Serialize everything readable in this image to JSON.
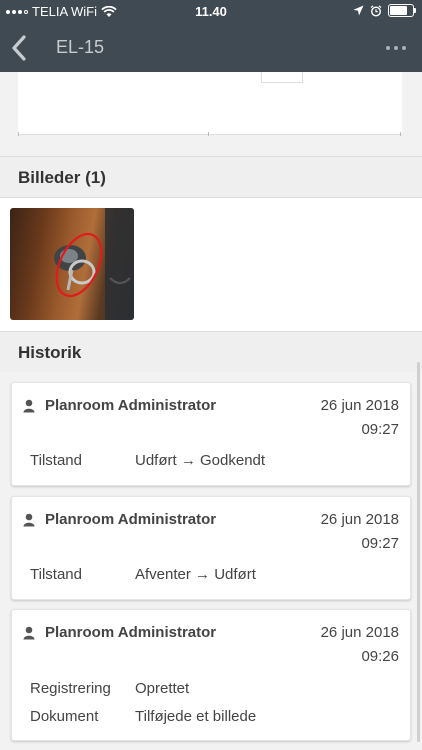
{
  "status_bar": {
    "carrier": "TELIA WiFi",
    "time": "11.40",
    "battery_level": 0.85
  },
  "nav": {
    "title": "EL-15",
    "back_icon": "chevron-left-icon",
    "more_icon": "more-horizontal-icon"
  },
  "images_section": {
    "title": "Billeder (1)"
  },
  "history_section": {
    "title": "Historik",
    "entries": [
      {
        "author": "Planroom Administrator",
        "date": "26 jun 2018",
        "time": "09:27",
        "rows": [
          {
            "field": "Tilstand",
            "value": "Udført → Godkendt"
          }
        ]
      },
      {
        "author": "Planroom Administrator",
        "date": "26 jun 2018",
        "time": "09:27",
        "rows": [
          {
            "field": "Tilstand",
            "value": "Afventer → Udført"
          }
        ]
      },
      {
        "author": "Planroom Administrator",
        "date": "26 jun 2018",
        "time": "09:26",
        "rows": [
          {
            "field": "Registrering",
            "value": "Oprettet"
          },
          {
            "field": "Dokument",
            "value": "Tilføjede et billede"
          }
        ]
      }
    ]
  },
  "colors": {
    "header_bg": "#3f4a52",
    "section_bg": "#efeff0",
    "annotation_red": "#e01b1b"
  }
}
